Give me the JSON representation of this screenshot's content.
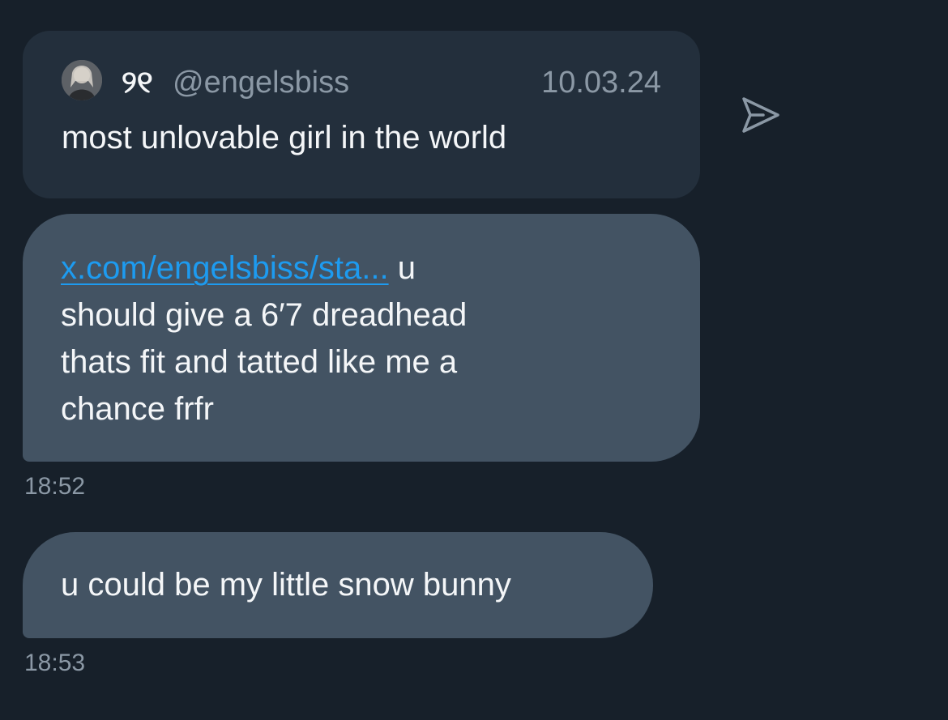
{
  "quoted_post": {
    "display_name": "୨୧",
    "handle": "@engelsbiss",
    "date": "10.03.24",
    "text": "most unlovable girl in the world"
  },
  "share_icon": "send-arrow-icon",
  "messages": [
    {
      "link_text": "x.com/engelsbiss/sta...",
      "line_1_rest": " u",
      "line_2": "should give a 6′7 dreadhead",
      "line_3": "thats fit and tatted like me a",
      "line_4": "chance frfr",
      "time": "18:52"
    },
    {
      "text": "u could be my little snow bunny",
      "time": "18:53"
    }
  ],
  "colors": {
    "background": "#17202a",
    "quote_card": "#232f3c",
    "bubble": "#435363",
    "link": "#1d9bf0",
    "muted_text": "#8b98a5"
  }
}
